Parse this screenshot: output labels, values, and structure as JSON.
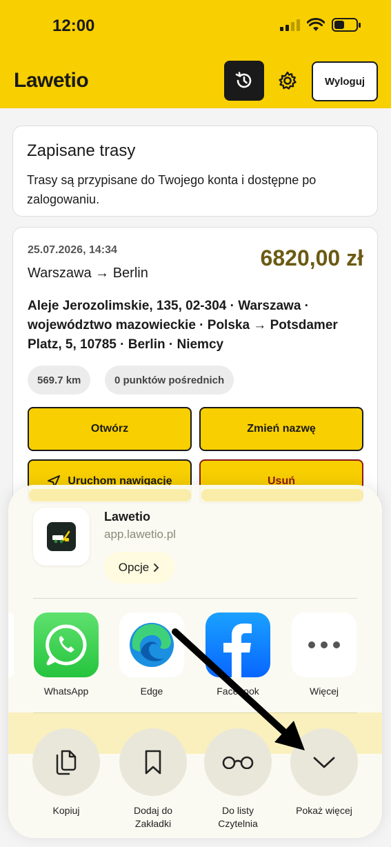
{
  "status": {
    "time": "12:00"
  },
  "header": {
    "brand": "Lawetio",
    "logout": "Wyloguj"
  },
  "saved_routes": {
    "title": "Zapisane trasy",
    "description": "Trasy są przypisane do Twojego konta i dostępne po zalogowaniu."
  },
  "route_card": {
    "date": "25.07.2026, 14:34",
    "route": "Warszawa → Berlin",
    "price": "6820,00 zł",
    "address": "Aleje Jerozolimskie, 135, 02-304 · Warszawa · województwo mazowieckie · Polska → Potsdamer Platz, 5, 10785 · Berlin · Niemcy",
    "distance": "569.7 km",
    "waypoints": "0 punktów pośrednich",
    "open": "Otwórz",
    "rename": "Zmień nazwę",
    "navigate": "Uruchom nawigację",
    "delete": "Usuń"
  },
  "share_sheet": {
    "app_name": "Lawetio",
    "url": "app.lawetio.pl",
    "options": "Opcje",
    "apps": [
      {
        "label": "WhatsApp",
        "icon": "whatsapp-icon"
      },
      {
        "label": "Edge",
        "icon": "edge-icon"
      },
      {
        "label": "Facebook",
        "icon": "facebook-icon"
      },
      {
        "label": "Więcej",
        "icon": "more-icon"
      }
    ],
    "actions": [
      {
        "label": "Kopiuj",
        "icon": "copy-icon"
      },
      {
        "label": "Dodaj do Zakładki",
        "icon": "bookmark-icon"
      },
      {
        "label": "Do listy Czytelnia",
        "icon": "reading-list-icon"
      },
      {
        "label": "Pokaż więcej",
        "icon": "chevron-down-icon"
      }
    ]
  },
  "colors": {
    "brand_yellow": "#f8cf00",
    "price": "#6b5a12",
    "delete_border": "#8b1a1a"
  }
}
